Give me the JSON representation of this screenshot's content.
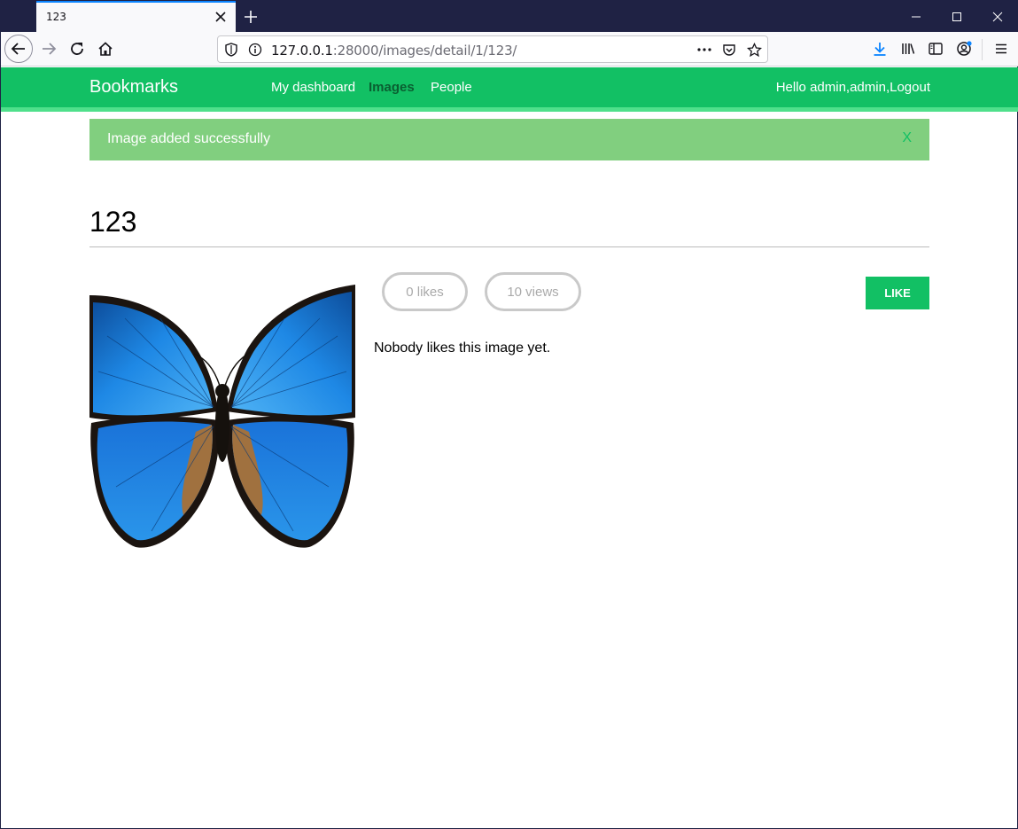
{
  "browser": {
    "tab_title": "123",
    "url_host": "127.0.0.1",
    "url_rest": ":28000/images/detail/1/123/"
  },
  "site": {
    "logo": "Bookmarks",
    "menu": [
      {
        "label": "My dashboard"
      },
      {
        "label": "Images"
      },
      {
        "label": "People"
      }
    ],
    "user_text": "Hello admin,admin,Logout",
    "brand_color": "#12c064"
  },
  "message": {
    "text": "Image added successfully",
    "close": "X"
  },
  "image": {
    "title": "123",
    "likes_label": "0 likes",
    "views_label": "10 views",
    "like_button": "LIKE",
    "likers_text": "Nobody likes this image yet."
  }
}
